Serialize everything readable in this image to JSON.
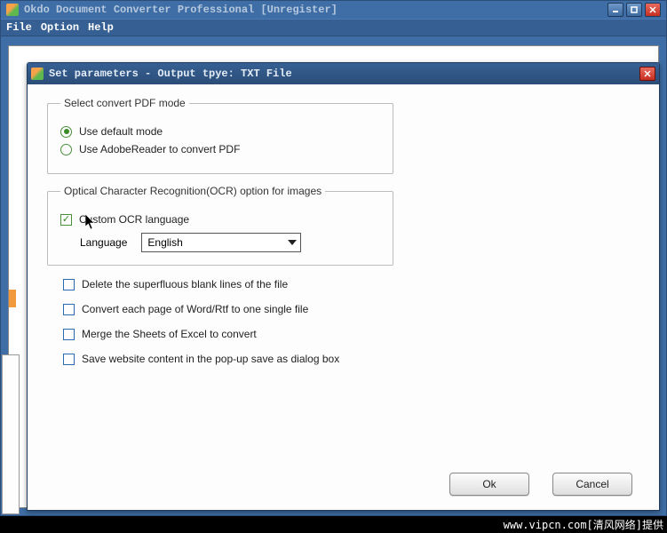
{
  "main_window": {
    "title": "Okdo Document Converter Professional [Unregister]",
    "menu": {
      "file": "File",
      "option": "Option",
      "help": "Help"
    }
  },
  "dialog": {
    "title": "Set parameters - Output tpye: TXT File",
    "pdf_group": {
      "legend": "Select convert PDF mode",
      "opt_default": "Use default mode",
      "opt_adobe": "Use AdobeReader to convert PDF"
    },
    "ocr_group": {
      "legend": "Optical Character Recognition(OCR) option for images",
      "chk_custom": "Custom OCR language",
      "lang_label": "Language",
      "lang_value": "English"
    },
    "chk_delete_blank": "Delete the superfluous blank lines of the file",
    "chk_single_file": "Convert each page of Word/Rtf to one single file",
    "chk_merge_excel": "Merge the Sheets of Excel to convert",
    "chk_save_website": "Save website content in the pop-up save as dialog box",
    "btn_ok": "Ok",
    "btn_cancel": "Cancel"
  },
  "footer": "www.vipcn.com[清风网络]提供"
}
